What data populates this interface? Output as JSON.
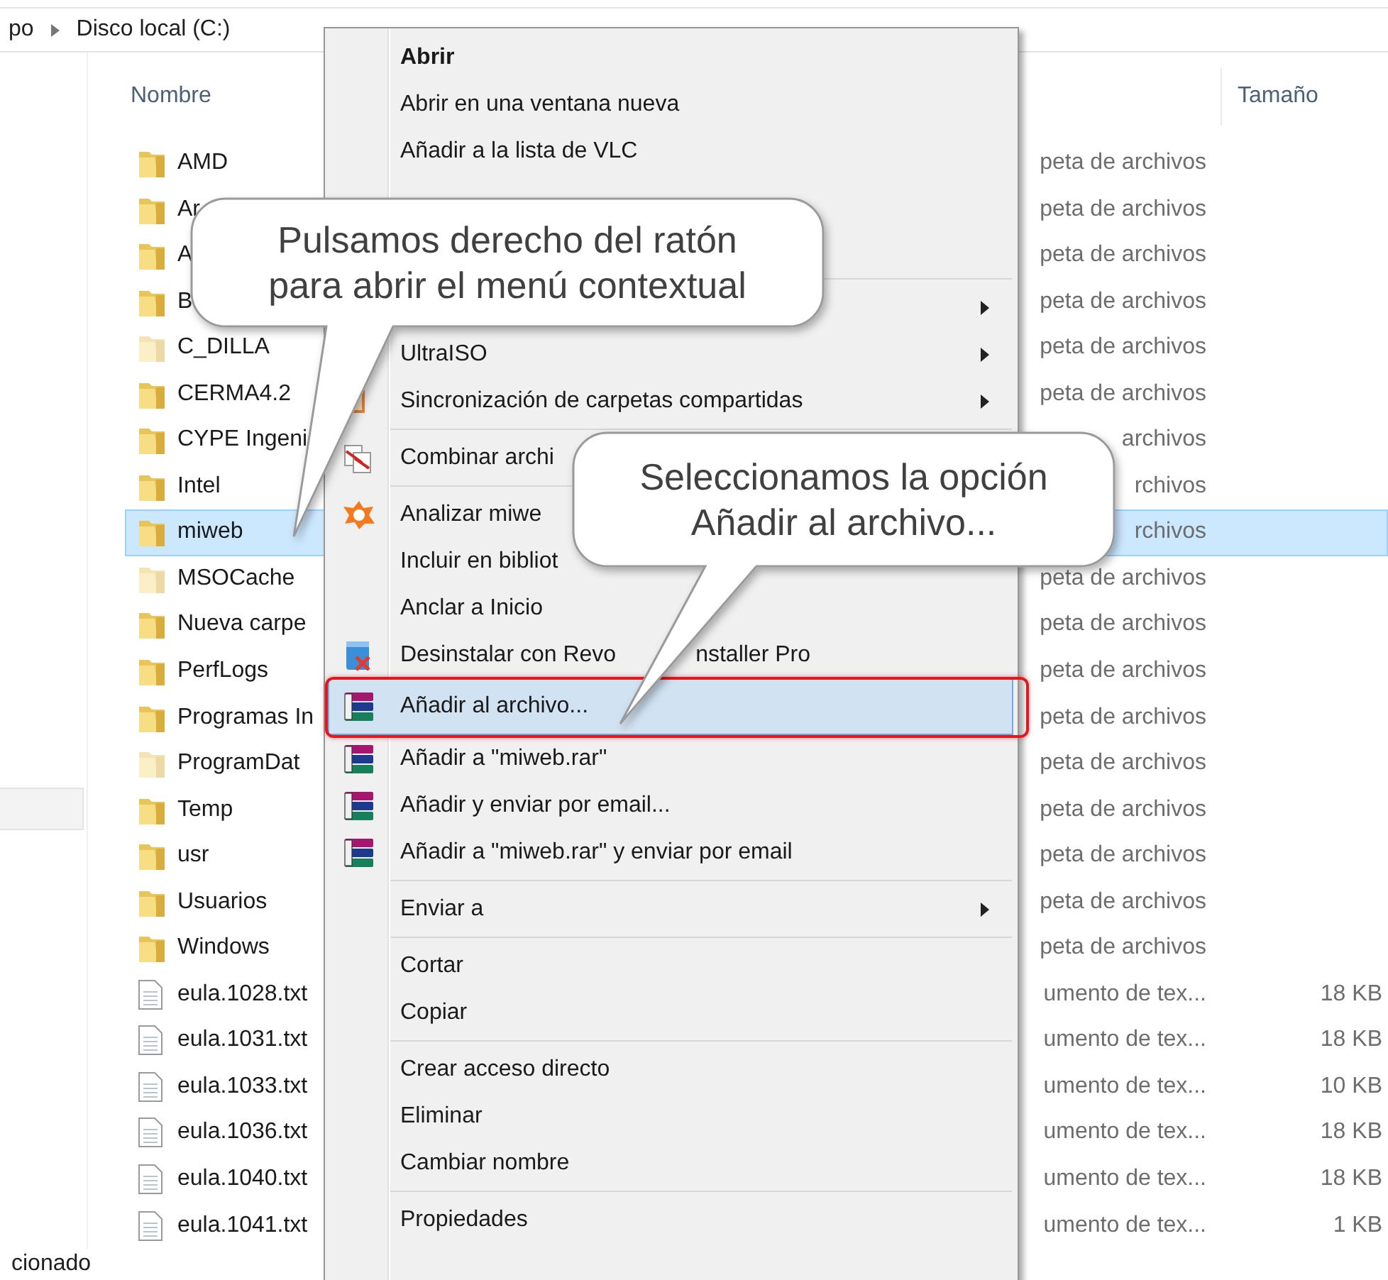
{
  "breadcrumb": [
    "po",
    "Disco local (C:)"
  ],
  "columns": [
    "Nombre",
    "Tamaño"
  ],
  "files": [
    {
      "name": "AMD",
      "kind": "folder",
      "type": "peta de archivos",
      "selected": false
    },
    {
      "name": "Ar",
      "kind": "folder",
      "type": "peta de archivos",
      "selected": false
    },
    {
      "name": "A",
      "kind": "folder",
      "type": "peta de archivos",
      "selected": false
    },
    {
      "name": "B",
      "kind": "folder",
      "type": "peta de archivos",
      "selected": false
    },
    {
      "name": "C_DILLA",
      "kind": "hidden-folder",
      "type": "peta de archivos",
      "selected": false
    },
    {
      "name": "CERMA4.2",
      "kind": "folder",
      "type": "peta de archivos",
      "selected": false
    },
    {
      "name": "CYPE Ingeni",
      "kind": "folder",
      "type": "archivos",
      "selected": false
    },
    {
      "name": "Intel",
      "kind": "folder",
      "type": "rchivos",
      "selected": false
    },
    {
      "name": "miweb",
      "kind": "folder",
      "type": "rchivos",
      "selected": true
    },
    {
      "name": "MSOCache",
      "kind": "hidden-folder",
      "type": "peta de archivos",
      "selected": false
    },
    {
      "name": "Nueva carpe",
      "kind": "folder",
      "type": "peta de archivos",
      "selected": false
    },
    {
      "name": "PerfLogs",
      "kind": "folder",
      "type": "peta de archivos",
      "selected": false
    },
    {
      "name": "Programas In",
      "kind": "folder",
      "type": "peta de archivos",
      "selected": false
    },
    {
      "name": "ProgramDat",
      "kind": "hidden-folder",
      "type": "peta de archivos",
      "selected": false
    },
    {
      "name": "Temp",
      "kind": "folder",
      "type": "peta de archivos",
      "selected": false
    },
    {
      "name": "usr",
      "kind": "folder",
      "type": "peta de archivos",
      "selected": false
    },
    {
      "name": "Usuarios",
      "kind": "folder",
      "type": "peta de archivos",
      "selected": false
    },
    {
      "name": "Windows",
      "kind": "folder",
      "type": "peta de archivos",
      "selected": false
    },
    {
      "name": "eula.1028.txt",
      "kind": "text",
      "type": "umento de tex...",
      "size": "18 KB",
      "selected": false
    },
    {
      "name": "eula.1031.txt",
      "kind": "text",
      "type": "umento de tex...",
      "size": "18 KB",
      "selected": false
    },
    {
      "name": "eula.1033.txt",
      "kind": "text",
      "type": "umento de tex...",
      "size": "10 KB",
      "selected": false
    },
    {
      "name": "eula.1036.txt",
      "kind": "text",
      "type": "umento de tex...",
      "size": "18 KB",
      "selected": false
    },
    {
      "name": "eula.1040.txt",
      "kind": "text",
      "type": "umento de tex...",
      "size": "18 KB",
      "selected": false
    },
    {
      "name": "eula.1041.txt",
      "kind": "text",
      "type": "umento de tex...",
      "size": "1 KB",
      "selected": false
    }
  ],
  "context_menu": [
    [
      {
        "label": "Abrir",
        "default": true,
        "submenu": false,
        "selected": false
      },
      {
        "label": "Abrir en una ventana nueva",
        "default": false,
        "submenu": false,
        "selected": false
      },
      {
        "label": "Añadir a la lista de VLC",
        "default": false,
        "submenu": false,
        "selected": false
      }
    ],
    [
      {
        "default": false,
        "submenu": true,
        "selected": false
      },
      {
        "label": "UltraISO",
        "default": false,
        "submenu": true,
        "selected": false
      },
      {
        "label": "Sincronización de carpetas compartidas",
        "kind": "sync",
        "default": false,
        "submenu": true,
        "selected": false
      }
    ],
    [
      {
        "label": "Combinar archi",
        "kind": "pdf",
        "default": false,
        "selected": false
      }
    ],
    [
      {
        "label": "Analizar miwe",
        "kind": "antivirus",
        "default": false,
        "selected": false
      },
      {
        "label": "Incluir en bibliot",
        "default": false,
        "submenu": false,
        "selected": false
      },
      {
        "label": "Anclar a Inicio",
        "default": false,
        "submenu": false,
        "selected": false
      },
      {
        "label": "Desinstalar con Revo",
        "label_after_pointer": "nstaller Pro",
        "kind": "uninstall",
        "default": false,
        "submenu": false,
        "selected": false
      },
      {
        "label": "Añadir al archivo...",
        "kind": "archive",
        "default": false,
        "submenu": false,
        "selected": true,
        "highlighted": true
      },
      {
        "label": "Añadir a \"miweb.rar\"",
        "kind": "archive",
        "default": false,
        "submenu": false,
        "selected": false
      },
      {
        "label": "Añadir y enviar por email...",
        "kind": "archive",
        "default": false,
        "submenu": false,
        "selected": false
      },
      {
        "label": "Añadir a \"miweb.rar\" y enviar por email",
        "kind": "archive",
        "default": false,
        "submenu": false,
        "selected": false
      }
    ],
    [
      {
        "label": "Enviar a",
        "default": false,
        "submenu": true,
        "selected": false
      }
    ],
    [
      {
        "label": "Cortar",
        "default": false,
        "submenu": false,
        "selected": false
      },
      {
        "label": "Copiar",
        "default": false,
        "submenu": false,
        "selected": false
      }
    ],
    [
      {
        "label": "Crear acceso directo",
        "default": false,
        "submenu": false,
        "selected": false
      },
      {
        "label": "Eliminar",
        "default": false,
        "submenu": false,
        "selected": false
      },
      {
        "label": "Cambiar nombre",
        "default": false,
        "submenu": false,
        "selected": false
      }
    ],
    [
      {
        "label": "Propiedades",
        "default": false,
        "submenu": false,
        "selected": false
      }
    ]
  ],
  "callouts": [
    {
      "text": "Pulsamos derecho del ratón\npara abrir el menú contextual"
    },
    {
      "text": "Seleccionamos la opción\nAñadir al archivo..."
    }
  ],
  "status_bar": "cionado"
}
